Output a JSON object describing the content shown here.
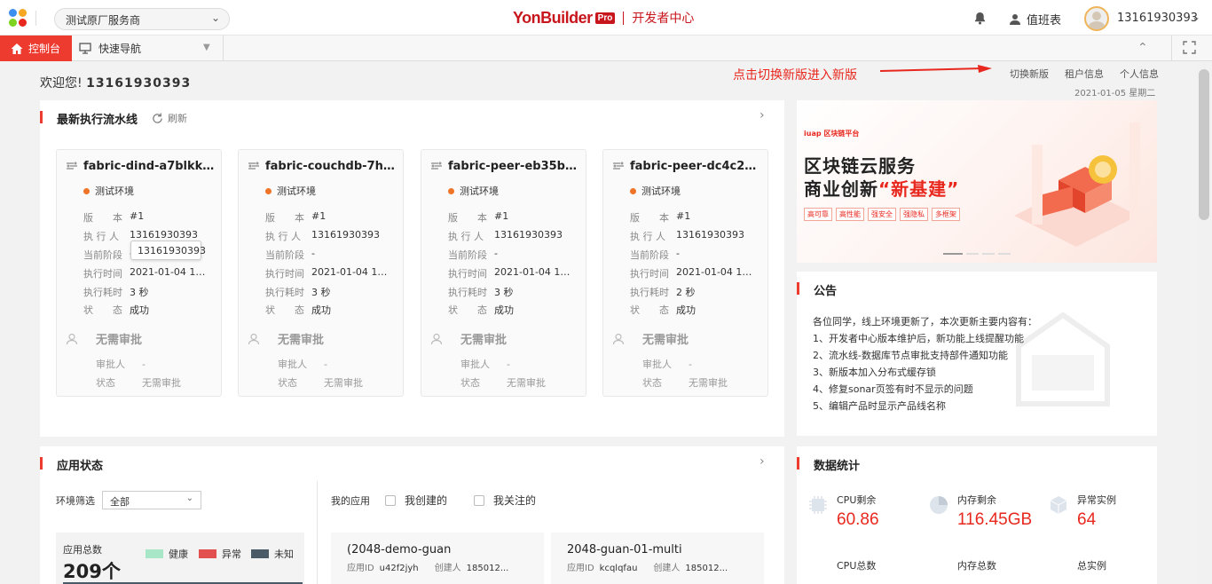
{
  "header": {
    "provider": "测试原厂服务商",
    "brand": "YonBuilder",
    "brand_badge": "Pro",
    "brand_sub": "开发者中心",
    "duty": "值班表",
    "username": "13161930393"
  },
  "nav": {
    "home_tab": "控制台",
    "quick_nav": "快速导航"
  },
  "welcome": {
    "prefix": "欢迎您!",
    "user": "13161930393",
    "hint": "点击切换新版进入新版",
    "links": [
      "切换新版",
      "租户信息",
      "个人信息"
    ],
    "date": "2021-01-05  星期二"
  },
  "pipelines": {
    "title": "最新执行流水线",
    "refresh": "刷新",
    "labels": {
      "version": "版　　本",
      "executor": "执 行 人",
      "stage": "当前阶段",
      "time": "执行时间",
      "duration": "执行耗时",
      "status": "状　　态",
      "approval": "无需审批",
      "approver": "审批人",
      "astatus": "状态"
    },
    "tooltip": "13161930393",
    "items": [
      {
        "name": "fabric-dind-a7blkk9...",
        "env": "测试环境",
        "version": "#1",
        "executor": "13161930393",
        "stage": "-",
        "time": "2021-01-04 18:...",
        "duration": "3 秒",
        "status": "成功",
        "approver": "-",
        "astatus": "无需审批"
      },
      {
        "name": "fabric-couchdb-7he...",
        "env": "测试环境",
        "version": "#1",
        "executor": "13161930393",
        "stage": "-",
        "time": "2021-01-04 18:...",
        "duration": "3 秒",
        "status": "成功",
        "approver": "-",
        "astatus": "无需审批"
      },
      {
        "name": "fabric-peer-eb35b5f...",
        "env": "测试环境",
        "version": "#1",
        "executor": "13161930393",
        "stage": "-",
        "time": "2021-01-04 18:...",
        "duration": "3 秒",
        "status": "成功",
        "approver": "-",
        "astatus": "无需审批"
      },
      {
        "name": "fabric-peer-dc4c214...",
        "env": "测试环境",
        "version": "#1",
        "executor": "13161930393",
        "stage": "-",
        "time": "2021-01-04 18:...",
        "duration": "2 秒",
        "status": "成功",
        "approver": "-",
        "astatus": "无需审批"
      }
    ]
  },
  "banner": {
    "small": "iuap 区块链平台",
    "line1": "区块链云服务",
    "line2a": "商业创新",
    "line2b": "“新基建”",
    "tags": [
      "高可靠",
      "高性能",
      "强安全",
      "强隐私",
      "多框架"
    ]
  },
  "notice": {
    "title": "公告",
    "lines": [
      "各位同学，线上环境更新了，本次更新主要内容有：",
      "1、开发者中心版本维护后，新功能上线提醒功能",
      "2、流水线-数据库节点审批支持部件通知功能",
      "3、新版本加入分布式缓存锁",
      "4、修复sonar页签有时不显示的问题",
      "5、编辑产品时显示产品线名称"
    ]
  },
  "app_status": {
    "title": "应用状态",
    "filter_label": "环境筛选",
    "filter_value": "全部",
    "my_apps": "我的应用",
    "created": "我创建的",
    "followed": "我关注的",
    "total_label": "应用总数",
    "total_value": "209个",
    "legend": [
      "健康",
      "异常",
      "未知"
    ],
    "colors": {
      "healthy": "#a8e6c8",
      "error": "#e25050",
      "unknown": "#4a5a66"
    },
    "apps": [
      {
        "name": "(2048-demo-guan",
        "id_label": "应用ID",
        "id": "u42f2jyh",
        "creator_label": "创建人",
        "creator": "185012..."
      },
      {
        "name": "2048-guan-01-multi",
        "id_label": "应用ID",
        "id": "kcqlqfau",
        "creator_label": "创建人",
        "creator": "185012..."
      }
    ]
  },
  "stats": {
    "title": "数据统计",
    "items": [
      {
        "label": "CPU剩余",
        "value": "60.86",
        "icon": "cpu-icon"
      },
      {
        "label": "内存剩余",
        "value": "116.45GB",
        "icon": "pie-icon"
      },
      {
        "label": "异常实例",
        "value": "64",
        "icon": "cube-icon"
      },
      {
        "label": "CPU总数",
        "value": "",
        "icon": ""
      },
      {
        "label": "内存总数",
        "value": "",
        "icon": ""
      },
      {
        "label": "总实例",
        "value": "",
        "icon": ""
      }
    ]
  }
}
